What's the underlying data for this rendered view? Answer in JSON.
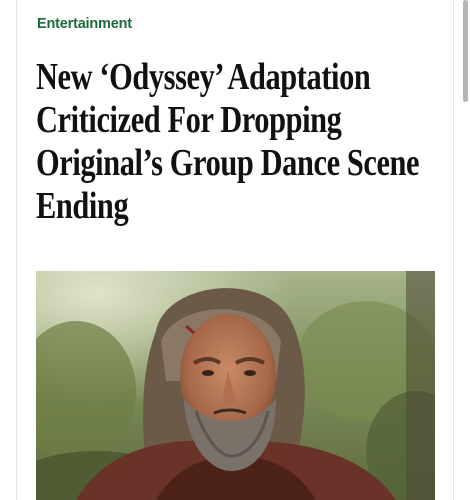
{
  "article": {
    "category": "Entertainment",
    "headline_lines": [
      "New ‘Odyssey’ Adaptation",
      "Criticized For Dropping",
      "Original’s Group Dance Scene",
      "Ending"
    ]
  },
  "colors": {
    "category": "#1e6b3a",
    "headline": "#111111",
    "background": "#ffffff"
  },
  "hero_image": {
    "subject": "bearded-man-photo"
  }
}
